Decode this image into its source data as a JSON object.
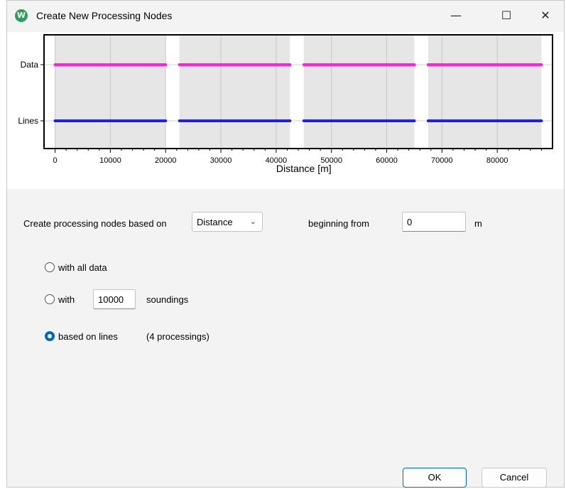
{
  "window": {
    "title": "Create New Processing Nodes",
    "minimize_glyph": "—",
    "maximize_glyph": "☐",
    "close_glyph": "✕",
    "app_icon": "W"
  },
  "chart_data": {
    "type": "line",
    "xlabel": "Distance [m]",
    "xlim": [
      -2000,
      90000
    ],
    "x_ticks": [
      0,
      10000,
      20000,
      30000,
      40000,
      50000,
      60000,
      70000,
      80000
    ],
    "x_tick_labels": [
      "0",
      "10000",
      "20000",
      "30000",
      "40000",
      "50000",
      "60000",
      "70000",
      "80000"
    ],
    "y_categories": [
      "Data",
      "Lines"
    ],
    "shaded_intervals": [
      [
        0,
        20000
      ],
      [
        22500,
        42500
      ],
      [
        45000,
        65000
      ],
      [
        67500,
        88000
      ]
    ],
    "series": [
      {
        "name": "Data",
        "color": "#ff22dd",
        "segments": [
          [
            0,
            20000
          ],
          [
            22500,
            42500
          ],
          [
            45000,
            65000
          ],
          [
            67500,
            88000
          ]
        ]
      },
      {
        "name": "Lines",
        "color": "#2222dd",
        "segments": [
          [
            0,
            20000
          ],
          [
            22500,
            42500
          ],
          [
            45000,
            65000
          ],
          [
            67500,
            88000
          ]
        ]
      }
    ],
    "grid": true
  },
  "form": {
    "based_on_label": "Create processing nodes based on",
    "based_on_value": "Distance",
    "beginning_label": "beginning from",
    "beginning_value": "0",
    "unit": "m",
    "option_all": "with all data",
    "option_with": "with",
    "soundings_value": "10000",
    "soundings_label": "soundings",
    "option_lines": "based on lines",
    "lines_count": "(4 processings)",
    "selected_option": "based on lines"
  },
  "buttons": {
    "ok": "OK",
    "cancel": "Cancel"
  }
}
